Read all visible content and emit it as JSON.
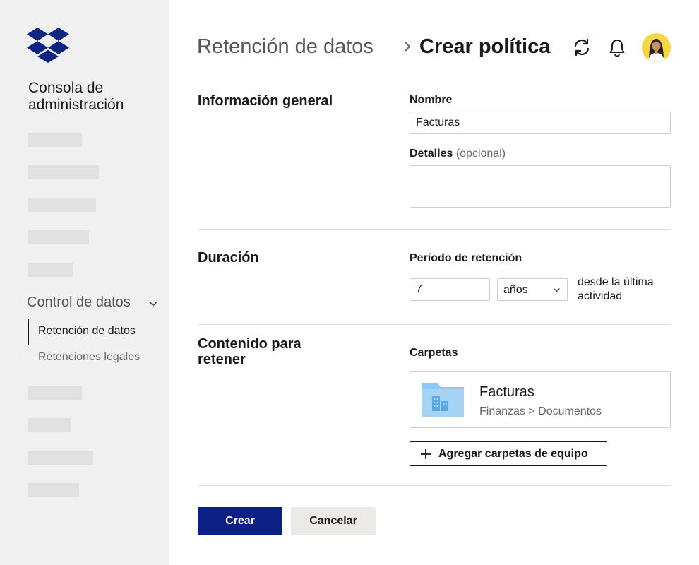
{
  "sidebar": {
    "console_title": "Consola de administración",
    "section": "Control de datos",
    "items": [
      {
        "label": "Retención de datos",
        "active": true
      },
      {
        "label": "Retenciones legales",
        "active": false
      }
    ]
  },
  "header": {
    "breadcrumb_parent": "Retención de datos",
    "breadcrumb_current": "Crear política",
    "icons": [
      "sync-icon",
      "bell-icon",
      "avatar"
    ]
  },
  "form": {
    "general": {
      "title": "Información general",
      "name_label": "Nombre",
      "name_value": "Facturas",
      "details_label": "Detalles",
      "details_optional": "(opcional)",
      "details_value": ""
    },
    "duration": {
      "title": "Duración",
      "period_label": "Período de retención",
      "period_value": "7",
      "unit_selected": "años",
      "suffix": "desde la última actividad"
    },
    "content": {
      "title": "Contenido para retener",
      "folders_label": "Carpetas",
      "folder": {
        "name": "Facturas",
        "path": "Finanzas > Documentos",
        "icon": "team-folder-icon"
      },
      "add_button": "Agregar carpetas de equipo"
    }
  },
  "actions": {
    "create": "Crear",
    "cancel": "Cancelar"
  },
  "colors": {
    "primary": "#0c2085",
    "brand": "#0d2481",
    "sidebar_bg": "#f0f0f0",
    "folder": "#8cc8f5",
    "avatar_bg": "#f7d545"
  }
}
